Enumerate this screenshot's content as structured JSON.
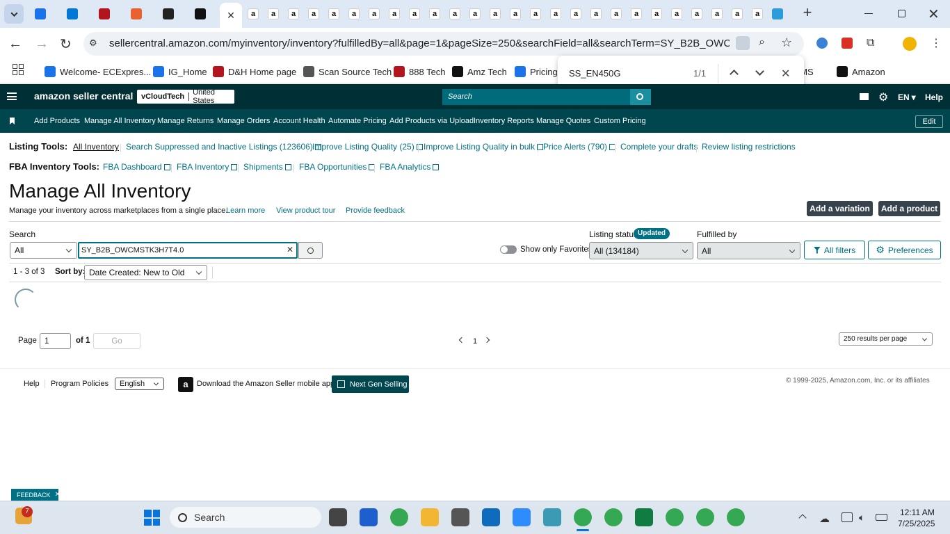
{
  "browser": {
    "url": "sellercentral.amazon.com/myinventory/inventory?fulfilledBy=all&page=1&pageSize=250&searchField=all&searchTerm=SY_B2B_OWCMSTK3H...",
    "bookmarks": [
      {
        "label": "Welcome- ECExpres..."
      },
      {
        "label": "IG_Home"
      },
      {
        "label": "D&H Home page"
      },
      {
        "label": "Scan Source Tech"
      },
      {
        "label": "888 Tech"
      },
      {
        "label": "Amz Tech"
      },
      {
        "label": "Pricing"
      },
      {
        "label": "g CMS"
      },
      {
        "label": "Amazon"
      }
    ],
    "find_bar": {
      "query": "SS_EN450G",
      "count": "1/1"
    }
  },
  "amazon_header": {
    "logo": "amazon seller central",
    "account": "vCloudTech",
    "marketplace": "United States",
    "search_placeholder": "Search",
    "lang": "EN",
    "help": "Help"
  },
  "nav": {
    "items": [
      "Add Products",
      "Manage All Inventory",
      "Manage Returns",
      "Manage Orders",
      "Account Health",
      "Automate Pricing",
      "Add Products via Upload",
      "Inventory Reports",
      "Manage Quotes",
      "Custom Pricing"
    ],
    "edit": "Edit"
  },
  "listing_tools": {
    "label": "Listing Tools:",
    "links": [
      "All Inventory",
      "Search Suppressed and Inactive Listings (123606)",
      "Improve Listing Quality (25)",
      "Improve Listing Quality in bulk",
      "Price Alerts (790)",
      "Complete your drafts",
      "Review listing restrictions"
    ]
  },
  "fba_tools": {
    "label": "FBA Inventory Tools:",
    "links": [
      "FBA Dashboard",
      "FBA Inventory",
      "Shipments",
      "FBA Opportunities",
      "FBA Analytics"
    ]
  },
  "page": {
    "title": "Manage All Inventory",
    "subtitle": "Manage your inventory across marketplaces from a single place.",
    "learn_more": "Learn more",
    "product_tour": "View product tour",
    "feedback": "Provide feedback",
    "add_variation": "Add a variation",
    "add_product": "Add a product"
  },
  "search": {
    "label": "Search",
    "scope": "All",
    "value": "SY_B2B_OWCMSTK3H7T4.0",
    "favorites": "Show only Favorites",
    "listing_status_label": "Listing status",
    "updated_badge": "Updated",
    "listing_status_value": "All (134184)",
    "fulfilled_by_label": "Fulfilled by",
    "fulfilled_by_value": "All",
    "all_filters": "All filters",
    "preferences": "Preferences"
  },
  "results": {
    "count": "1 - 3 of 3",
    "sort_label": "Sort by:",
    "sort_value": "Date Created: New to Old"
  },
  "pagination": {
    "page_label": "Page",
    "page_value": "1",
    "of_label": "of 1",
    "go": "Go",
    "current": "1",
    "per_page": "250 results per page"
  },
  "footer": {
    "help": "Help",
    "policies": "Program Policies",
    "language": "English",
    "mobile_app": "Download the Amazon Seller mobile app",
    "next_gen": "Next Gen Selling",
    "copyright": "© 1999-2025, Amazon.com, Inc. or its affiliates"
  },
  "feedback_tab": "FEEDBACK",
  "taskbar": {
    "search": "Search",
    "time": "12:11 AM",
    "date": "7/25/2025",
    "badge": "7"
  }
}
